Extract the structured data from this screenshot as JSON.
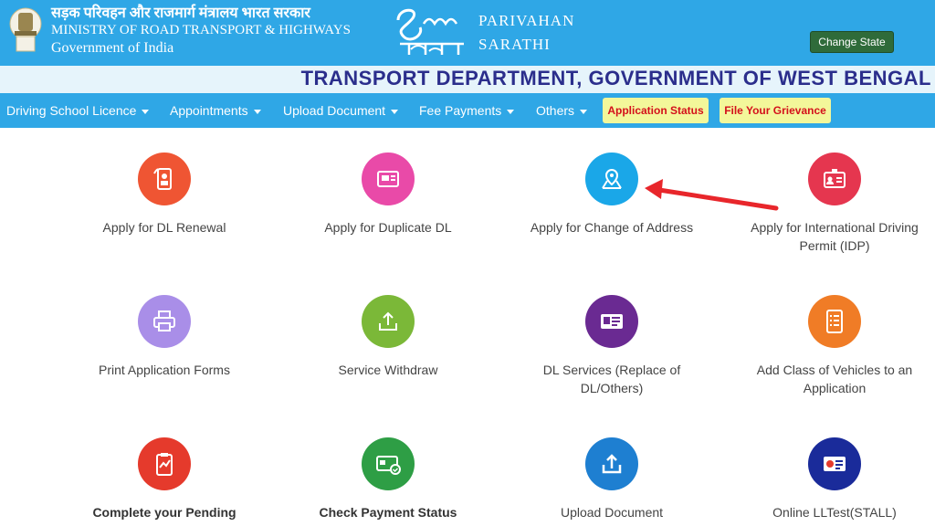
{
  "header": {
    "ministry_hindi": "सड़क परिवहन और राजमार्ग मंत्रालय भारत सरकार",
    "ministry_english": "MINISTRY OF ROAD TRANSPORT & HIGHWAYS",
    "government": "Government of India",
    "brand_line1": "PARIVAHAN",
    "brand_line2": "SARATHI",
    "change_state": "Change State",
    "department": "TRANSPORT DEPARTMENT, GOVERNMENT OF WEST BENGAL"
  },
  "nav": {
    "items": [
      "Driving School Licence",
      "Appointments",
      "Upload Document",
      "Fee Payments",
      "Others"
    ],
    "application_status": "Application Status",
    "file_grievance": "File Your Grievance"
  },
  "tiles": [
    {
      "label": "Apply for DL Renewal",
      "color": "#ef5533",
      "icon": "dl-renewal-icon"
    },
    {
      "label": "Apply for Duplicate DL",
      "color": "#e94aa8",
      "icon": "duplicate-dl-icon"
    },
    {
      "label": "Apply for Change of Address",
      "color": "#1aa7e8",
      "icon": "map-pin-icon"
    },
    {
      "label": "Apply for International Driving Permit (IDP)",
      "color": "#e5364f",
      "icon": "id-card-icon"
    },
    {
      "label": "Print Application Forms",
      "color": "#a98ee8",
      "icon": "printer-icon"
    },
    {
      "label": "Service Withdraw",
      "color": "#7bb838",
      "icon": "upload-tray-icon"
    },
    {
      "label": "DL Services (Replace of DL/Others)",
      "color": "#6a2a92",
      "icon": "license-card-icon"
    },
    {
      "label": "Add Class of Vehicles to an Application",
      "color": "#f07c26",
      "icon": "form-list-icon"
    },
    {
      "label": "Complete your Pending",
      "color": "#e53a2c",
      "icon": "clipboard-icon"
    },
    {
      "label": "Check Payment Status",
      "color": "#2e9e45",
      "icon": "payment-card-icon"
    },
    {
      "label": "Upload Document",
      "color": "#1e7fd1",
      "icon": "upload-icon"
    },
    {
      "label": "Online LLTest(STALL)",
      "color": "#1a2b9a",
      "icon": "test-card-icon"
    }
  ]
}
